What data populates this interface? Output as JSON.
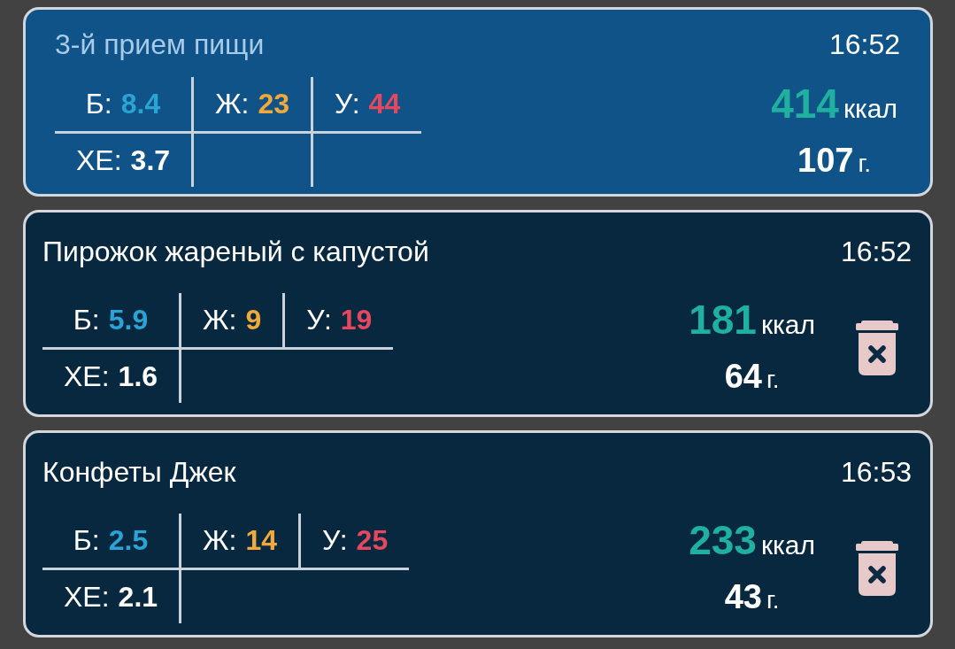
{
  "entries": [
    {
      "kind": "meal",
      "title": "3-й прием пищи",
      "time": "16:52",
      "nutrients": [
        {
          "label": "Б:",
          "value": "8.4",
          "color": "#2ba3d4"
        },
        {
          "label": "Ж:",
          "value": "23",
          "color": "#f2a93b"
        },
        {
          "label": "У:",
          "value": "44",
          "color": "#e5485e"
        }
      ],
      "bread_units": {
        "label": "ХЕ:",
        "value": "3.7"
      },
      "calories": {
        "value": "414",
        "unit": "ккал"
      },
      "weight": {
        "value": "107",
        "unit": "г."
      }
    },
    {
      "kind": "food",
      "title": "Пирожок жареный с капустой",
      "time": "16:52",
      "nutrients": [
        {
          "label": "Б:",
          "value": "5.9",
          "color": "#2ba3d4"
        },
        {
          "label": "Ж:",
          "value": "9",
          "color": "#f2a93b"
        },
        {
          "label": "У:",
          "value": "19",
          "color": "#e5485e"
        }
      ],
      "bread_units": {
        "label": "ХЕ:",
        "value": "1.6"
      },
      "calories": {
        "value": "181",
        "unit": "ккал"
      },
      "weight": {
        "value": "64",
        "unit": "г."
      }
    },
    {
      "kind": "food",
      "title": "Конфеты Джек",
      "time": "16:53",
      "nutrients": [
        {
          "label": "Б:",
          "value": "2.5",
          "color": "#2ba3d4"
        },
        {
          "label": "Ж:",
          "value": "14",
          "color": "#f2a93b"
        },
        {
          "label": "У:",
          "value": "25",
          "color": "#e5485e"
        }
      ],
      "bread_units": {
        "label": "ХЕ:",
        "value": "2.1"
      },
      "calories": {
        "value": "233",
        "unit": "ккал"
      },
      "weight": {
        "value": "43",
        "unit": "г."
      }
    }
  ]
}
